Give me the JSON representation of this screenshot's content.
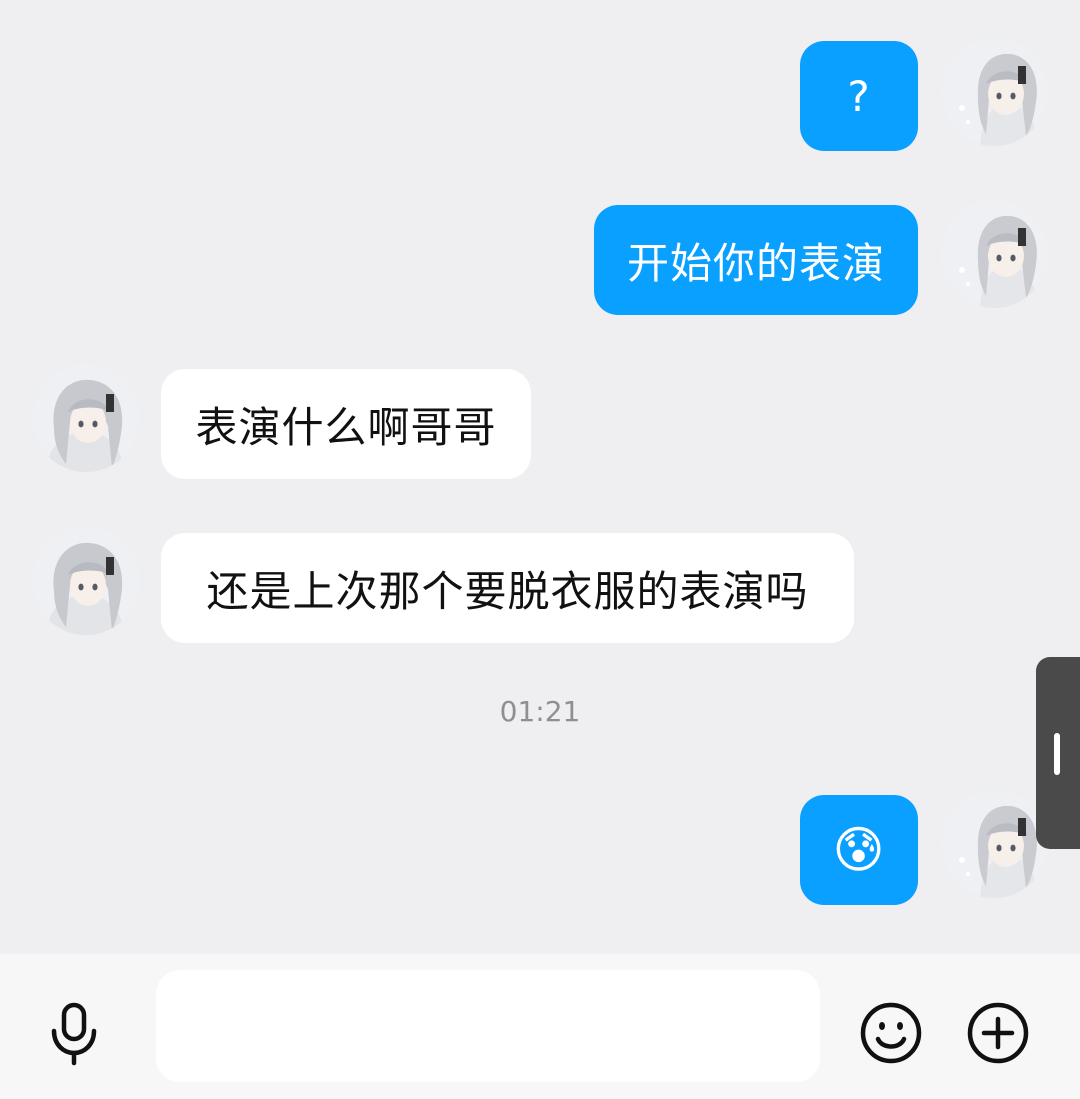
{
  "messages": [
    {
      "side": "sent",
      "text": "?"
    },
    {
      "side": "sent",
      "text": "开始你的表演"
    },
    {
      "side": "received",
      "text": "表演什么啊哥哥"
    },
    {
      "side": "received",
      "text": "还是上次那个要脱衣服的表演吗"
    },
    {
      "side": "sent",
      "text": "😰"
    }
  ],
  "timestamp": "01:21",
  "input_bar": {
    "message_placeholder": "",
    "icons": [
      "microphone-icon",
      "emoji-icon",
      "plus-icon"
    ]
  },
  "colors": {
    "sent_bubble": "#0aa0ff",
    "received_bubble": "#ffffff",
    "background": "#efeff2"
  }
}
